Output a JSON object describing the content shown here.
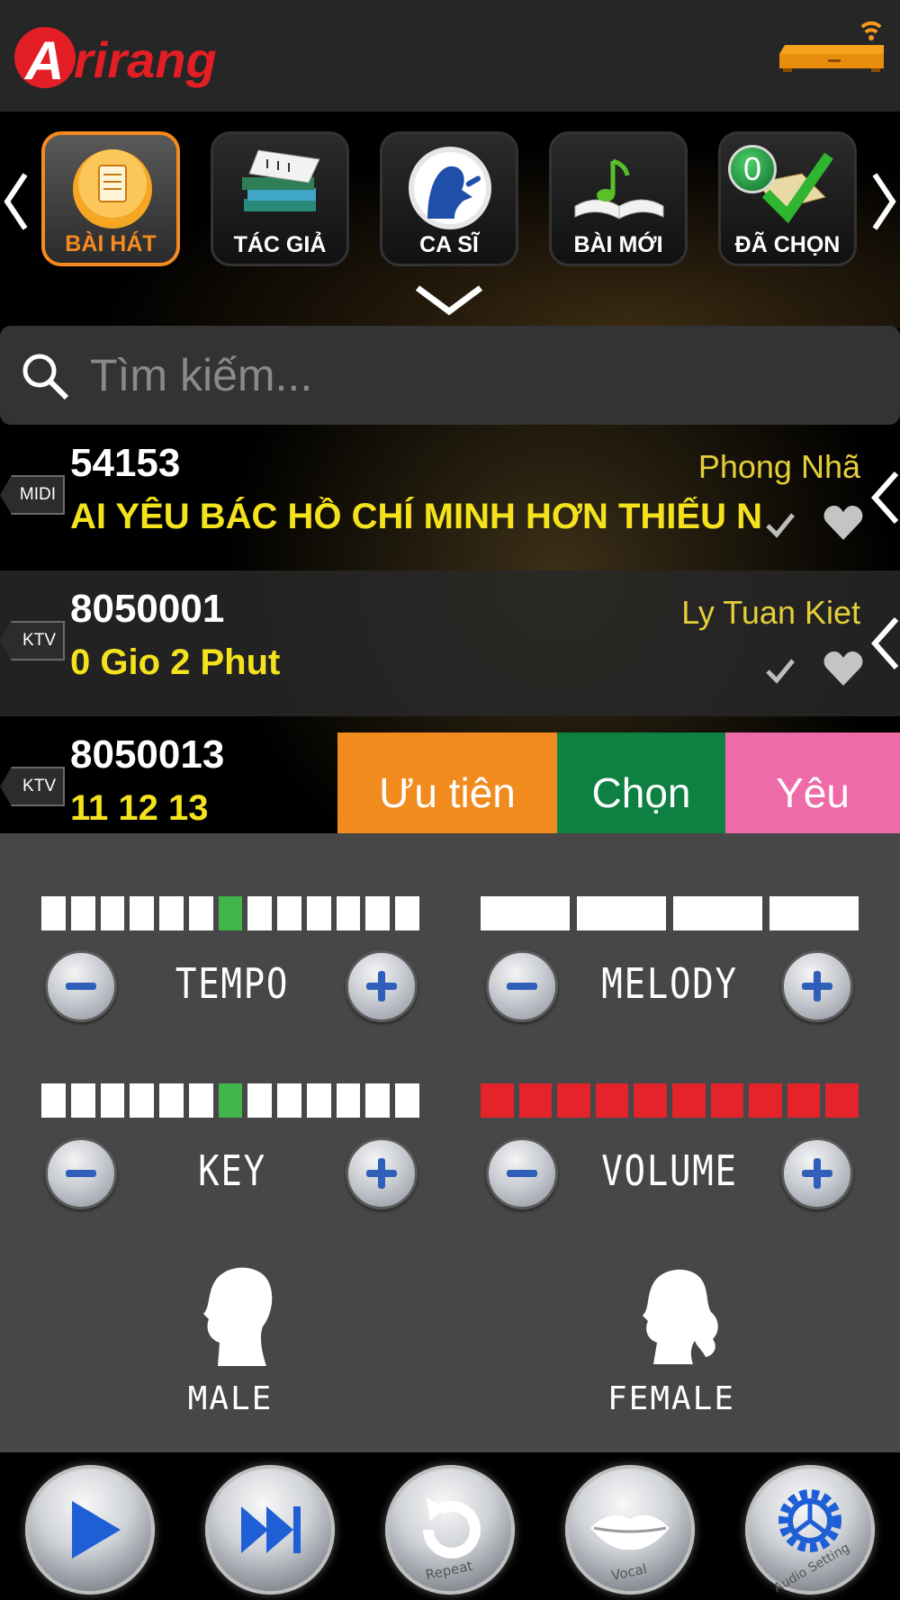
{
  "header": {
    "logo_text": "Arirang",
    "logo_color": "#e31e24"
  },
  "categories": [
    {
      "label": "BÀI HÁT",
      "icon": "song-document-icon",
      "active": true
    },
    {
      "label": "TÁC GIẢ",
      "icon": "composer-books-icon",
      "active": false
    },
    {
      "label": "CA SĨ",
      "icon": "singer-microphone-icon",
      "active": false
    },
    {
      "label": "BÀI MỚI",
      "icon": "new-songs-book-icon",
      "active": false
    },
    {
      "label": "ĐÃ CHỌN",
      "icon": "selected-check-icon",
      "active": false,
      "badge": "0"
    }
  ],
  "search": {
    "placeholder": "Tìm kiếm..."
  },
  "songs": [
    {
      "type": "MIDI",
      "code": "54153",
      "title": "AI YÊU BÁC HỒ CHÍ MINH HƠN THIẾU NI...",
      "artist": "Phong Nhã"
    },
    {
      "type": "KTV",
      "code": "8050001",
      "title": "0 Gio 2 Phut",
      "artist": "Ly Tuan Kiet"
    },
    {
      "type": "KTV",
      "code": "8050013",
      "title": "11 12 13",
      "artist": ""
    }
  ],
  "swipe_actions": {
    "priority": "Ưu tiên",
    "select": "Chọn",
    "favorite": "Yêu thích"
  },
  "controls": {
    "tempo": {
      "label": "TEMPO",
      "level": 7,
      "segments": 13
    },
    "melody": {
      "label": "MELODY",
      "level": 0,
      "segments": 4
    },
    "key": {
      "label": "KEY",
      "level": 7,
      "segments": 13
    },
    "volume": {
      "label": "VOLUME",
      "level": 10,
      "segments": 10
    }
  },
  "voice": {
    "male": "MALE",
    "female": "FEMALE"
  },
  "player": {
    "repeat_label": "Repeat",
    "vocal_label": "Vocal",
    "audio_setting_label": "Audio Setting"
  },
  "colors": {
    "accent_orange": "#f58a1f",
    "title_yellow": "#f4e31c",
    "meter_green": "#3fb54a",
    "meter_red": "#e5232a",
    "button_blue": "#1f5fd6"
  }
}
